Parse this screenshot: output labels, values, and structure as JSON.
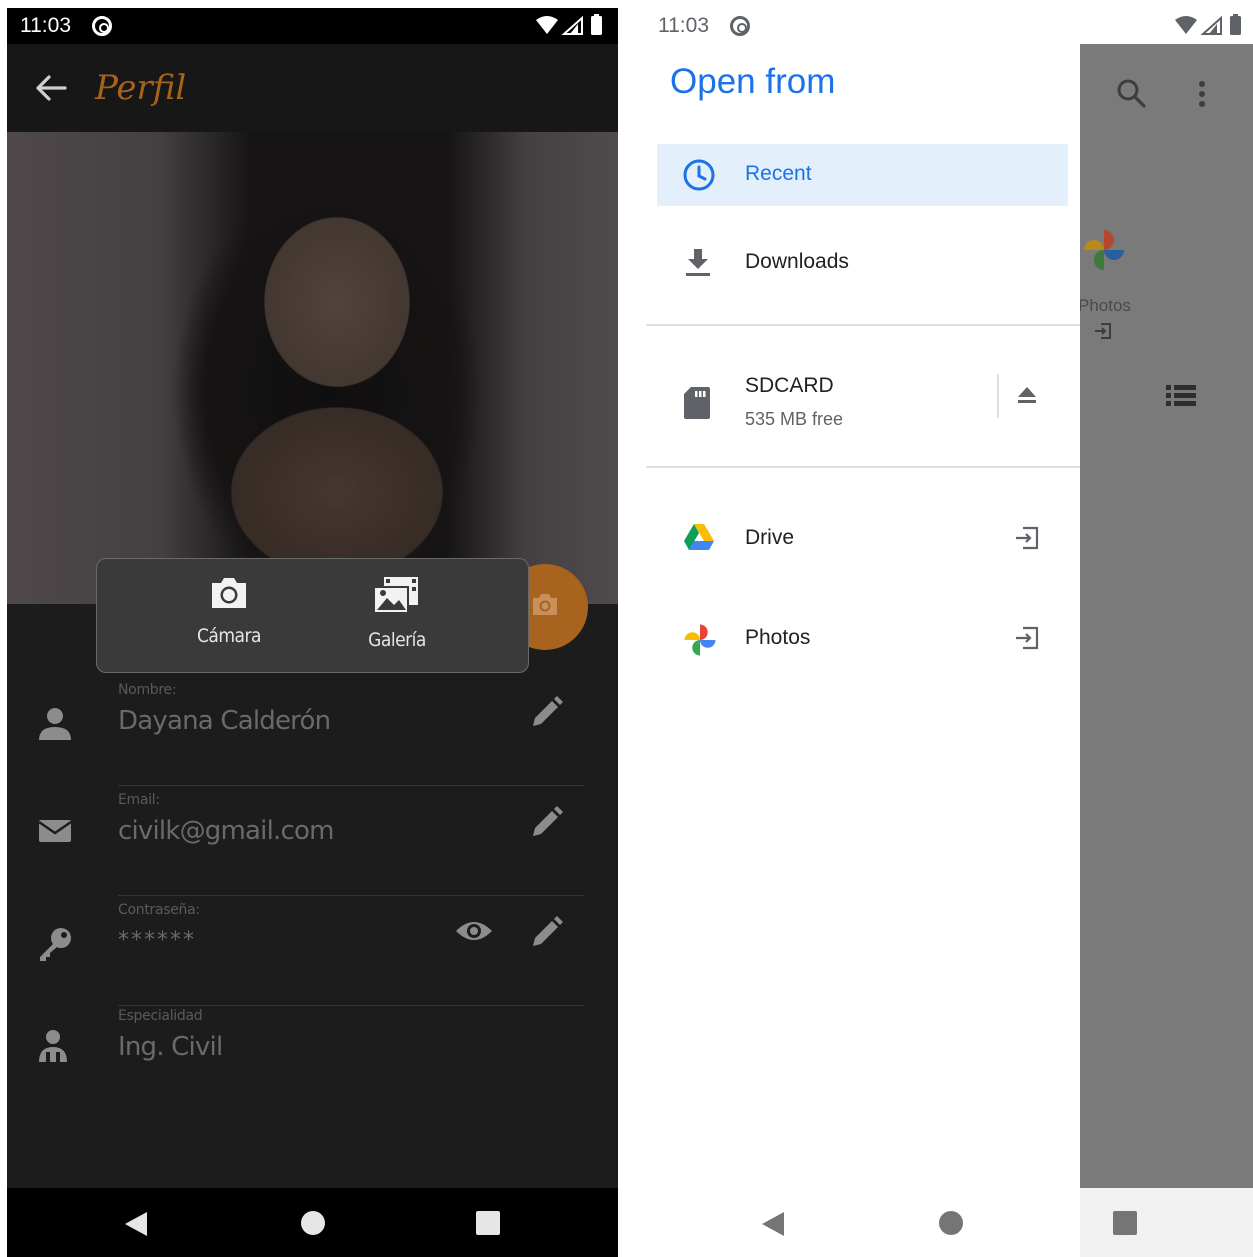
{
  "left": {
    "status": {
      "time": "11:03"
    },
    "appbar": {
      "title": "Perfil"
    },
    "popup": {
      "camera_label": "Cámara",
      "gallery_label": "Galería"
    },
    "fields": [
      {
        "label": "Nombre:",
        "value": "Dayana Calderón",
        "icon": "person-icon"
      },
      {
        "label": "Email:",
        "value": "civilk@gmail.com",
        "icon": "mail-icon"
      },
      {
        "label": "Contraseña:",
        "value": "******",
        "icon": "key-icon"
      },
      {
        "label": "Especialidad",
        "value": "Ing. Civil",
        "icon": "engineer-icon"
      }
    ],
    "colors": {
      "accent": "#a8641f",
      "background": "#1c1c1c"
    }
  },
  "right": {
    "status": {
      "time": "11:03"
    },
    "drawer": {
      "heading": "Open from",
      "recent": "Recent",
      "downloads": "Downloads",
      "sdcard": {
        "name": "SDCARD",
        "free": "535 MB free"
      },
      "drive": "Drive",
      "photos": "Photos"
    },
    "behind": {
      "photos_label": "Photos"
    },
    "colors": {
      "accent": "#1a73e8",
      "selected_bg": "#e3f0fb"
    }
  }
}
